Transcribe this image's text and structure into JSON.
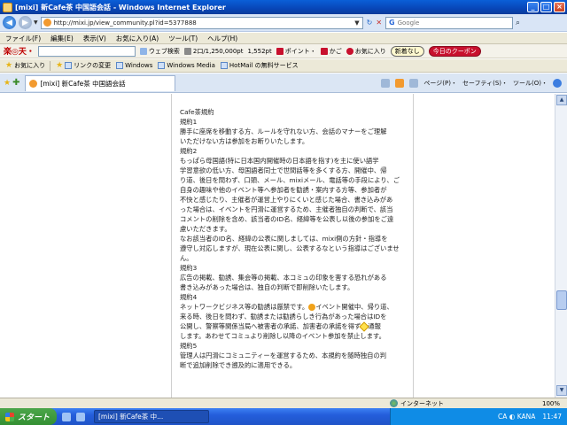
{
  "window": {
    "title": "[mixi] 新Cafe茶 中国語会話 - Windows Internet Explorer"
  },
  "address": {
    "url": "http://mixi.jp/view_community.pl?id=5377888",
    "search_placeholder": "Google"
  },
  "menu": [
    "ファイル(F)",
    "編集(E)",
    "表示(V)",
    "お気に入り(A)",
    "ツール(T)",
    "ヘルプ(H)"
  ],
  "rakuten": {
    "logo": "楽◎天・",
    "web_search": "ウェブ検索",
    "points": "2口/1,250,000pt",
    "pt": "1,552pt",
    "point_btn": "ポイント・",
    "cart_btn": "かご",
    "fav_btn": "お気に入り",
    "new_btn": "新着なし",
    "coupon_btn": "今日のクーポン"
  },
  "favorites": {
    "label": "お気に入り",
    "items": [
      "リンクの変更",
      "Windows",
      "Windows Media",
      "HotMail の無料サービス"
    ]
  },
  "tabs": {
    "active_label": "[mixi] 新Cafe茶 中国語会話",
    "commands": [
      "ページ(P)・",
      "セーフティ(S)・",
      "ツール(O)・"
    ]
  },
  "article": {
    "lines": [
      "Cafe茶規約",
      "規約1",
      "勝手に座席を移動する方、ルールを守れない方、会話のマナーをご理解",
      "いただけない方は参加をお断りいたします。",
      "規約2",
      "もっぱら母国語(特に日本国内開催時の日本語を指す)を主に使い語学",
      "学習意欲の低い方、母国語者同士で世間話等を多くする方、開催中、帰",
      "り道、後日を問わず、口頭、メール、mixiメール、電話等の手段により、ご",
      "自身の趣味や他のイベント等へ参加者を勧誘・案内する方等、参加者が",
      "不快と感じたり、主催者が運営上やりにくいと感じた場合、書き込みがあ",
      "った場合は、イベントを円滑に運営するため、主催者独自の判断で、該当",
      "コメントの削除を含め、該当者のID名、経緯等を公表し以後の参加をご遠",
      "慮いただきます。",
      "なお該当者のID名、経緯の公表に関しましては、mixi側の方針・指導を",
      "遵守し対応しますが、現在公表に関し、公表するなという指導はございませ",
      "ん。",
      "規約3",
      "広告の掲載、勧誘、集会等の掲載、本コミュの印象を害する恐れがある",
      "書き込みがあった場合は、独自の判断で即削除いたします。",
      "規約4",
      "ネットワークビジネス等の勧誘は厳禁です。",
      "イベント開催中、帰り道、",
      "来る時、後日を問わず、勧誘または勧誘らしき行為があった場合はIDを",
      "公開し、警察等関係当局へ被害者の承諾、加害者の承諾を得ず",
      "通報",
      "します。あわせてコミュより削除し以降のイベント参加を禁止します。",
      "規約5",
      "管理人は円滑にコミュニティーを運営するため、本規約を随時独自の判",
      "断で追加削除でき遡及的に適用できる。"
    ]
  },
  "status": {
    "zone": "インターネット",
    "zoom": "100%"
  },
  "taskbar": {
    "start": "スタート",
    "task": "[mixi] 新Cafe茶 中...",
    "time": "11:47"
  }
}
